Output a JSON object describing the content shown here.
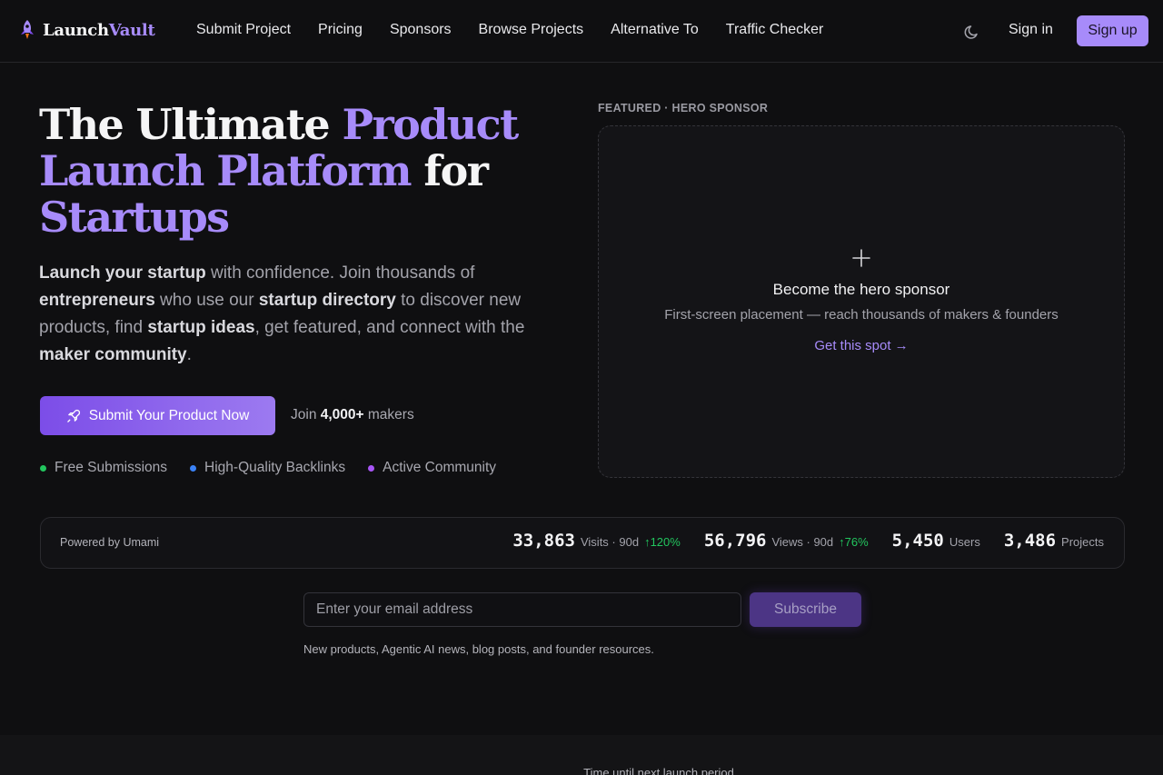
{
  "brand": {
    "name_part1": "Launch",
    "name_part2": "Vault",
    "accent_color": "#a78bfa",
    "logo_icon": "rocket-icon"
  },
  "nav": {
    "links": [
      "Submit Project",
      "Pricing",
      "Sponsors",
      "Browse Projects",
      "Alternative To",
      "Traffic Checker"
    ],
    "theme_icon": "moon-icon",
    "signin": "Sign in",
    "signup": "Sign up"
  },
  "hero": {
    "title_1": "The Ultimate ",
    "title_2": "Product Launch Platform",
    "title_3": " for ",
    "title_4": "Startups",
    "desc": {
      "b1": "Launch your startup",
      "t1": " with confidence. Join thousands of ",
      "b2": "entrepreneurs",
      "t2": " who use our ",
      "b3": "startup directory",
      "t3": " to discover new products, find ",
      "b4": "startup ideas",
      "t4": ", get featured, and connect with the ",
      "b5": "maker community",
      "t5": "."
    },
    "cta_label": "Submit Your Product Now",
    "cta_icon": "rocket-icon",
    "join_pre": "Join ",
    "join_count": "4,000+",
    "join_post": " makers",
    "features": [
      {
        "label": "Free Submissions",
        "color": "#22c55e"
      },
      {
        "label": "High-Quality Backlinks",
        "color": "#3b82f6"
      },
      {
        "label": "Active Community",
        "color": "#a855f7"
      }
    ]
  },
  "sponsor": {
    "label": "FEATURED · HERO SPONSOR",
    "icon": "plus-icon",
    "title": "Become the hero sponsor",
    "subtitle": "First-screen placement — reach thousands of makers & founders",
    "link": "Get this spot →"
  },
  "stats": {
    "powered_by": "Powered by Umami",
    "items": [
      {
        "value": "33,863",
        "label": "Visits · 90d",
        "change": "↑120%"
      },
      {
        "value": "56,796",
        "label": "Views · 90d",
        "change": "↑76%"
      },
      {
        "value": "5,450",
        "label": "Users",
        "change": ""
      },
      {
        "value": "3,486",
        "label": "Projects",
        "change": ""
      }
    ]
  },
  "newsletter": {
    "placeholder": "Enter your email address",
    "button": "Subscribe",
    "note": "New products, Agentic AI news, blog posts, and founder resources."
  },
  "countdown": {
    "label": "Time until next launch period"
  }
}
